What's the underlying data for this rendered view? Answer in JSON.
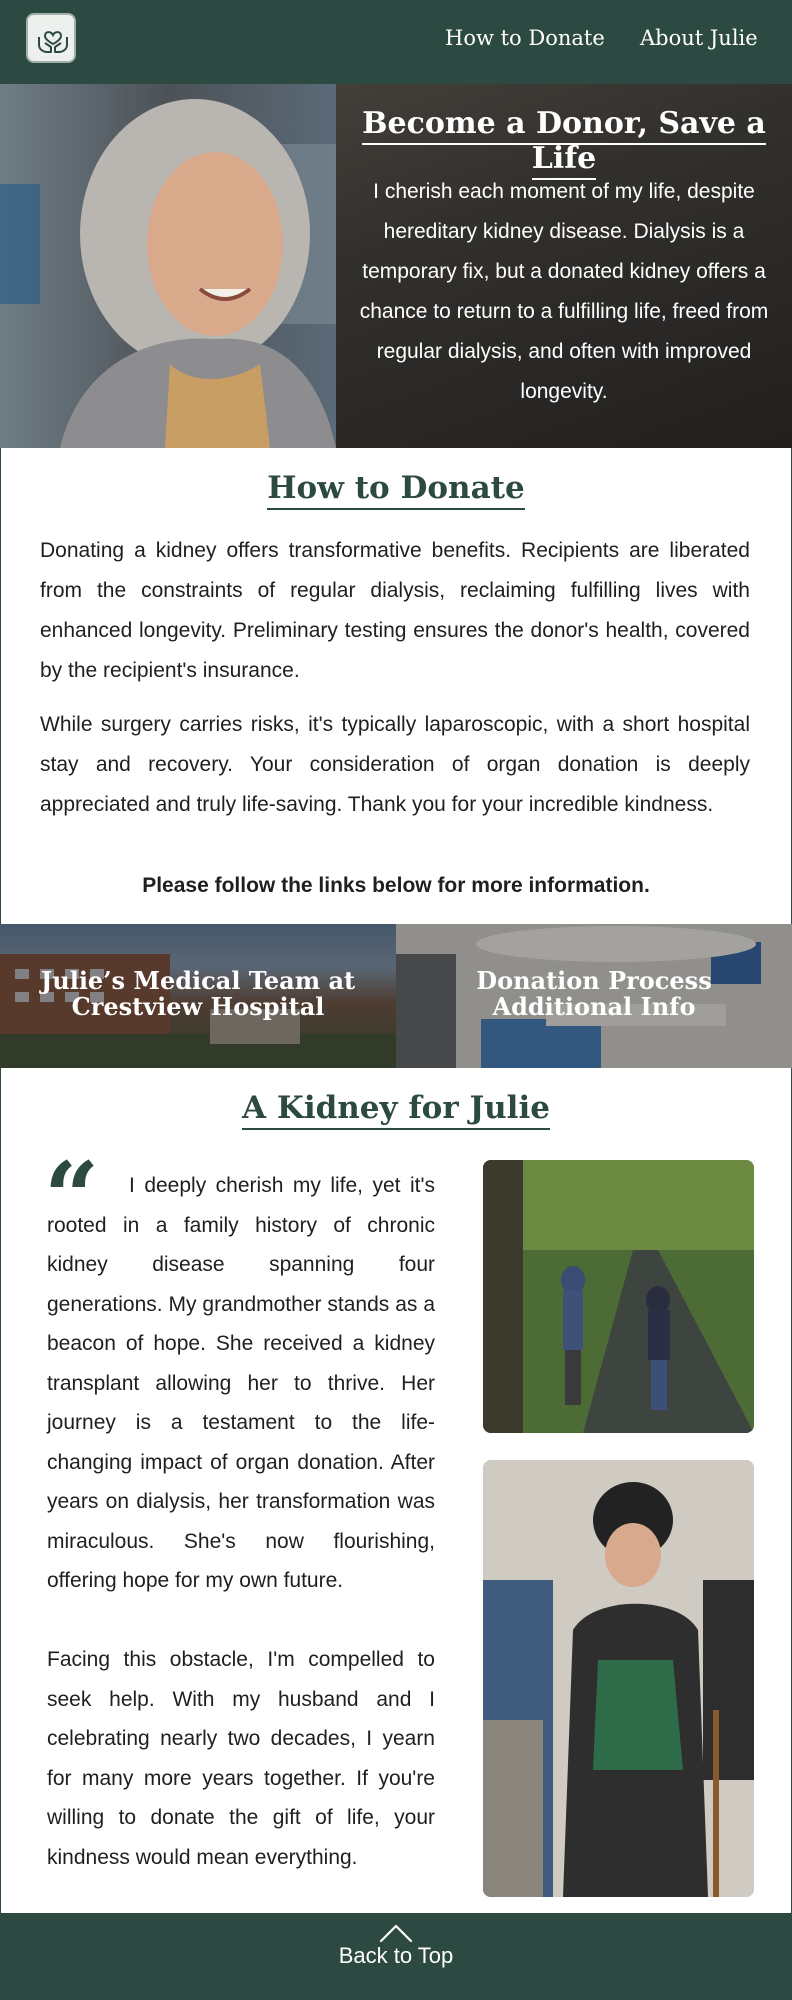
{
  "header": {
    "logo_icon": "hands-heart-icon",
    "nav": [
      {
        "label": "How to Donate"
      },
      {
        "label": "About Julie"
      }
    ]
  },
  "hero": {
    "title": "Become a Donor, Save a Life",
    "text": "I cherish each moment of my life, despite hereditary kidney disease. Dialysis is a temporary fix, but a donated kidney offers a chance to return to a fulfilling life, freed from regular dialysis, and often with improved longevity."
  },
  "how_to_donate": {
    "title": "How to Donate",
    "paragraph1": "Donating a kidney offers transformative benefits. Recipients are liberated from the constraints of regular dialysis, reclaiming fulfilling lives with enhanced longevity. Preliminary testing ensures the donor's health, covered by the recipient's insurance.",
    "paragraph2": "While surgery carries risks, it's typically laparoscopic, with a short hospital stay and recovery. Your consideration of organ donation is deeply appreciated and truly life-saving. Thank you for your incredible kindness.",
    "follow_note": "Please follow the links below for more information."
  },
  "link_panels": {
    "medical_team": {
      "line1": "Julie’s Medical Team at",
      "line2": "Crestview Hospital"
    },
    "donation_process": {
      "line1": "Donation Process",
      "line2": "Additional Info"
    }
  },
  "kidney_for_julie": {
    "title": "A Kidney for Julie",
    "quote_mark": "“",
    "story1": "I deeply cherish my life, yet it's rooted in a family history of chronic kidney disease spanning four generations. My grandmother stands as a beacon of hope. She received a kidney transplant allowing her to thrive. Her journey is a testament to the life-changing impact of organ donation. After years on dialysis, her transformation was miraculous. She's now flourishing, offering hope for my own future.",
    "story2": "Facing this obstacle, I'm compelled to seek help. With my husband and I celebrating nearly two decades, I yearn for many more years together. If you're willing to  donate the gift of life, your kindness would mean everything."
  },
  "footer": {
    "back_to_top": "Back to Top",
    "icon": "chevron-up-icon"
  },
  "colors": {
    "brand": "#2c4a41",
    "text": "#1f1f1f",
    "background": "#ffffff"
  }
}
